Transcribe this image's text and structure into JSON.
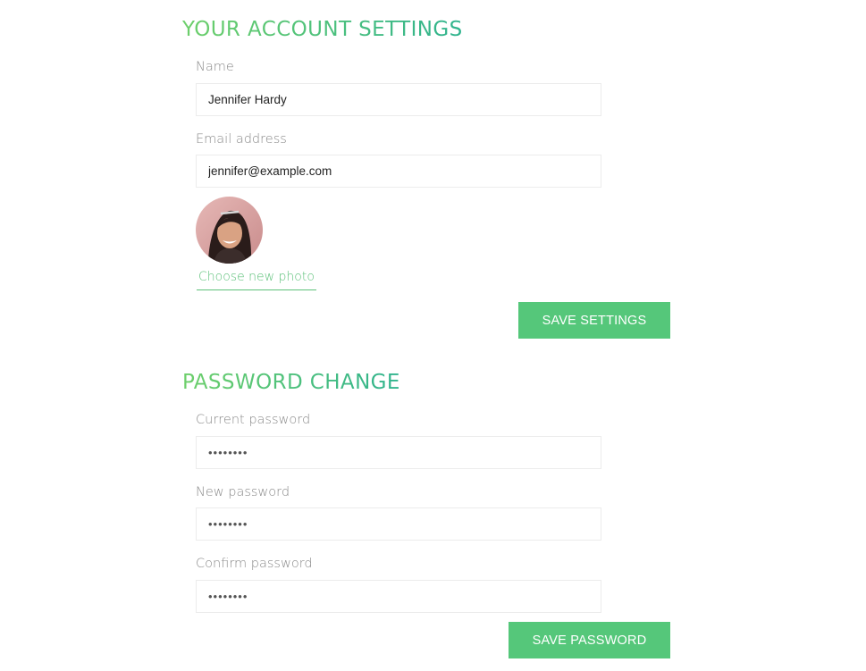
{
  "account": {
    "title": "YOUR ACCOUNT SETTINGS",
    "name_label": "Name",
    "name_value": "Jennifer Hardy",
    "email_label": "Email address",
    "email_value": "jennifer@example.com",
    "choose_photo_label": "Choose new photo",
    "save_label": "SAVE SETTINGS"
  },
  "password": {
    "title": "PASSWORD CHANGE",
    "current_label": "Current password",
    "current_value": "••••••••",
    "new_label": "New password",
    "new_value": "••••••••",
    "confirm_label": "Confirm password",
    "confirm_value": "••••••••",
    "save_label": "SAVE PASSWORD"
  },
  "colors": {
    "accent": "#55c77a",
    "title_gradient_start": "#6dcf6a",
    "title_gradient_end": "#2fb38e"
  }
}
